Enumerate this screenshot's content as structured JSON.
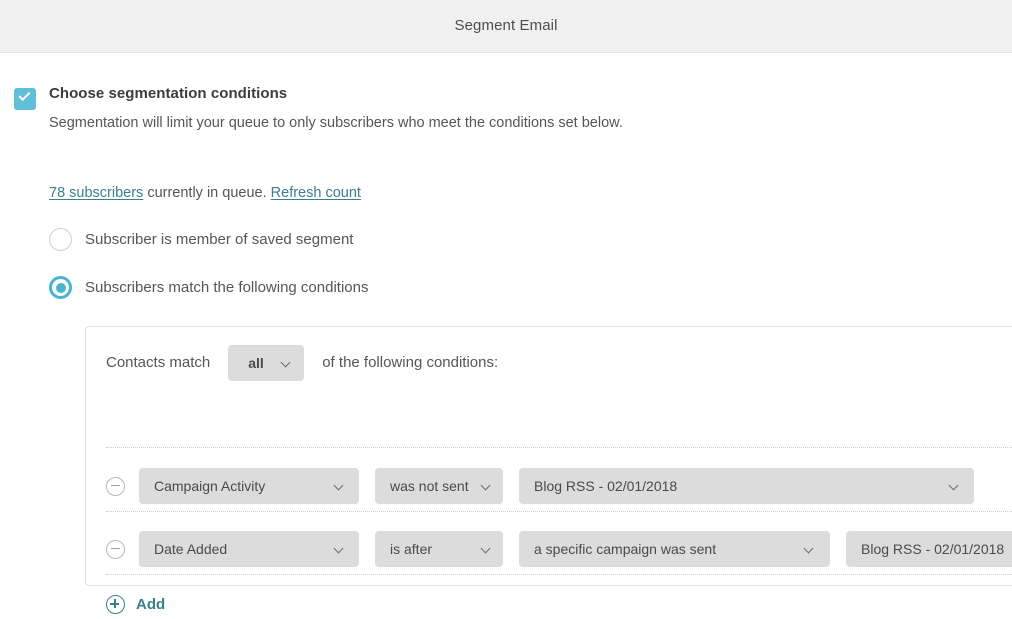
{
  "header": {
    "title": "Segment Email"
  },
  "segmentation": {
    "checkbox_checked": true,
    "title": "Choose segmentation conditions",
    "description": "Segmentation will limit your queue to only subscribers who meet the conditions set below.",
    "count_link": "78 subscribers",
    "count_text": " currently in queue. ",
    "refresh_link": "Refresh count",
    "accent_color": "#61bfd8",
    "link_color": "#3a7f8e"
  },
  "radios": [
    {
      "label": "Subscriber is member of saved segment",
      "selected": false
    },
    {
      "label": "Subscribers match the following conditions",
      "selected": true
    }
  ],
  "conditions_panel": {
    "match_prefix": "Contacts match",
    "match_value": "all",
    "match_suffix": "of the following conditions:",
    "rows": [
      {
        "field": "Campaign Activity",
        "operator": "was not sent",
        "value": "Blog RSS - 02/01/2018"
      },
      {
        "field": "Date Added",
        "operator": "is after",
        "value": "a specific campaign was sent",
        "value2": "Blog RSS - 02/01/2018"
      }
    ],
    "remove_icon": "minus-circle-icon",
    "add_icon": "plus-circle-icon",
    "add_label": "Add"
  }
}
